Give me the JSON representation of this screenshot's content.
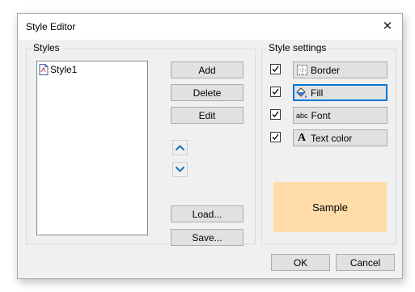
{
  "window": {
    "title": "Style Editor",
    "close_glyph": "✕"
  },
  "styles_group": {
    "label": "Styles",
    "items": [
      {
        "label": "Style1",
        "icon": "style-file-icon"
      }
    ]
  },
  "buttons": {
    "add": "Add",
    "delete": "Delete",
    "edit": "Edit",
    "load": "Load...",
    "save": "Save...",
    "move_up_icon": "chevron-up-icon",
    "move_down_icon": "chevron-down-icon"
  },
  "settings_group": {
    "label": "Style settings",
    "items": [
      {
        "label": "Border",
        "checked": true,
        "icon": "border-icon"
      },
      {
        "label": "Fill",
        "checked": true,
        "icon": "fill-bucket-icon",
        "focused": true
      },
      {
        "label": "Font",
        "checked": true,
        "icon": "abc-font-icon",
        "icon_text": "abc"
      },
      {
        "label": "Text color",
        "checked": true,
        "icon": "text-color-icon",
        "icon_text": "A"
      }
    ]
  },
  "sample": {
    "label": "Sample",
    "background": "#ffdcaa"
  },
  "footer": {
    "ok": "OK",
    "cancel": "Cancel"
  },
  "colors": {
    "accent": "#0078d7",
    "arrow": "#1a6fb5"
  }
}
